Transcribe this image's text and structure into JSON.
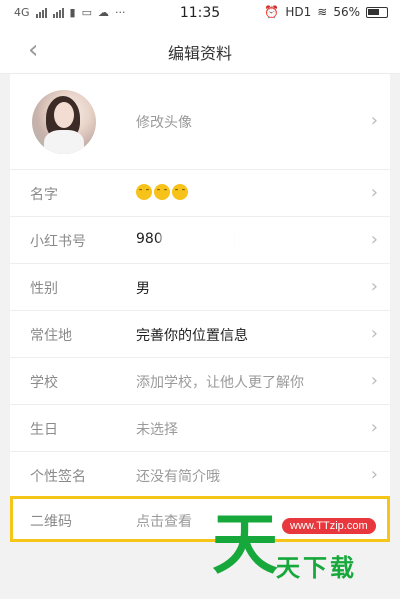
{
  "status_bar": {
    "network": "4G",
    "time": "11:35",
    "hd_label": "HD1",
    "battery": "56%"
  },
  "nav": {
    "back_icon": "chevron-left-icon",
    "title": "编辑资料"
  },
  "profile_rows": [
    {
      "label": "",
      "value": "修改头像"
    },
    {
      "label": "名字",
      "value": ""
    },
    {
      "label": "小红书号",
      "value": "980"
    },
    {
      "label": "性别",
      "value": "男"
    },
    {
      "label": "常住地",
      "value": "完善你的位置信息"
    },
    {
      "label": "学校",
      "value": "添加学校，让他人更了解你"
    },
    {
      "label": "生日",
      "value": "未选择"
    },
    {
      "label": "个性签名",
      "value": "还没有简介哦"
    },
    {
      "label": "二维码",
      "value": "点击查看"
    }
  ],
  "name_emoji_count": 3,
  "watermark": {
    "url": "www.TTzip.com",
    "big_char": "天",
    "text": "天下载"
  },
  "colors": {
    "highlight": "#f5c518",
    "watermark_green": "#17a83c",
    "watermark_red": "#e8383d"
  }
}
